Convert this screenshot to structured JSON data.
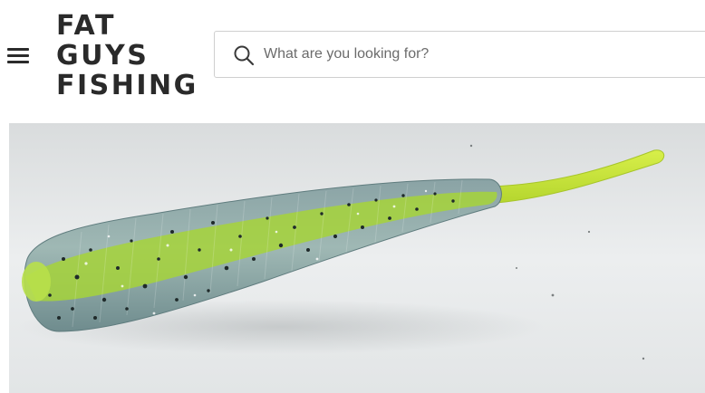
{
  "header": {
    "menu_icon": "hamburger-menu-icon",
    "logo_lines": [
      "FAT",
      "GUYS",
      "FISHING"
    ],
    "search": {
      "icon": "search-icon",
      "placeholder": "What are you looking for?",
      "value": ""
    }
  },
  "hero": {
    "image": "soft-plastic-fishing-lure-photo",
    "colors": {
      "body": "#8fa8a6",
      "stripe": "#a6d43a",
      "tail": "#c8e63c",
      "background": "#e6e9ea"
    }
  }
}
